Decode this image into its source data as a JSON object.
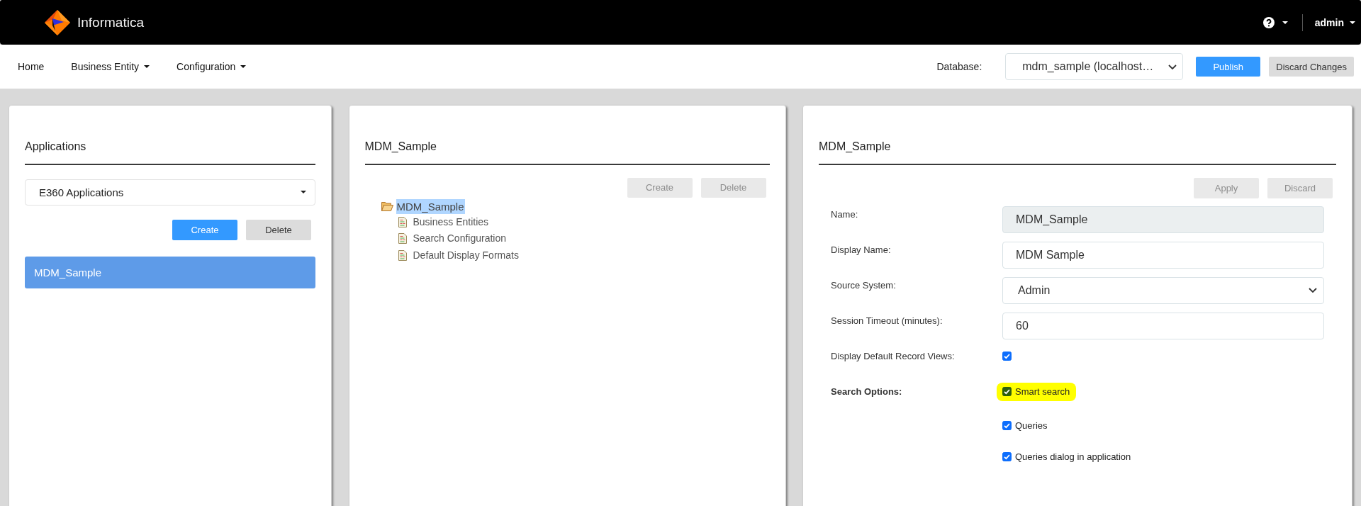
{
  "header": {
    "logo_text": "Informatica",
    "user": "admin"
  },
  "nav": {
    "items": [
      {
        "label": "Home",
        "has_menu": false
      },
      {
        "label": "Business Entity",
        "has_menu": true
      },
      {
        "label": "Configuration",
        "has_menu": true
      }
    ],
    "database_label": "Database:",
    "database_value": "mdm_sample (localhost…",
    "buttons": [
      {
        "label": "Publish",
        "kind": "primary",
        "disabled": false
      },
      {
        "label": "Discard Changes",
        "kind": "secondary",
        "disabled": false
      }
    ]
  },
  "applications_panel": {
    "title": "Applications",
    "dropdown": "E360 Applications",
    "buttons": [
      {
        "label": "Create",
        "kind": "primary",
        "disabled": false
      },
      {
        "label": "Delete",
        "kind": "secondary",
        "disabled": false
      }
    ],
    "items": [
      {
        "label": "MDM_Sample",
        "selected": true
      }
    ]
  },
  "tree_panel": {
    "title": "MDM_Sample",
    "buttons": [
      {
        "label": "Create",
        "kind": "secondary",
        "disabled": true
      },
      {
        "label": "Delete",
        "kind": "secondary",
        "disabled": true
      }
    ],
    "tree": [
      {
        "label": "MDM_Sample",
        "selected": true,
        "expanded": true,
        "children": [
          {
            "label": "Business Entities",
            "selected": false
          },
          {
            "label": "Search Configuration",
            "selected": false
          },
          {
            "label": "Default Display Formats",
            "selected": false
          }
        ]
      }
    ]
  },
  "detail_panel": {
    "title": "MDM_Sample",
    "buttons": [
      {
        "label": "Apply",
        "kind": "secondary",
        "disabled": true
      },
      {
        "label": "Discard",
        "kind": "secondary",
        "disabled": true
      }
    ],
    "fields": [
      {
        "kind": "text",
        "label": "Name:",
        "value": "MDM_Sample",
        "disabled": true
      },
      {
        "kind": "text",
        "label": "Display Name:",
        "value": "MDM Sample",
        "disabled": false
      },
      {
        "kind": "select",
        "label": "Source System:",
        "value": "Admin",
        "disabled": false
      },
      {
        "kind": "text",
        "label": "Session Timeout (minutes):",
        "value": "60",
        "disabled": false
      },
      {
        "kind": "checkbox",
        "label": "Display Default Record Views:",
        "checked": true,
        "disabled": false
      },
      {
        "kind": "options",
        "label": "Search Options:",
        "disabled": false,
        "options": [
          {
            "label": "Smart search",
            "checked": true,
            "highlighted": true
          },
          {
            "label": "Queries",
            "checked": true,
            "highlighted": false
          },
          {
            "label": "Queries dialog in application",
            "checked": true,
            "highlighted": false
          }
        ]
      }
    ]
  }
}
